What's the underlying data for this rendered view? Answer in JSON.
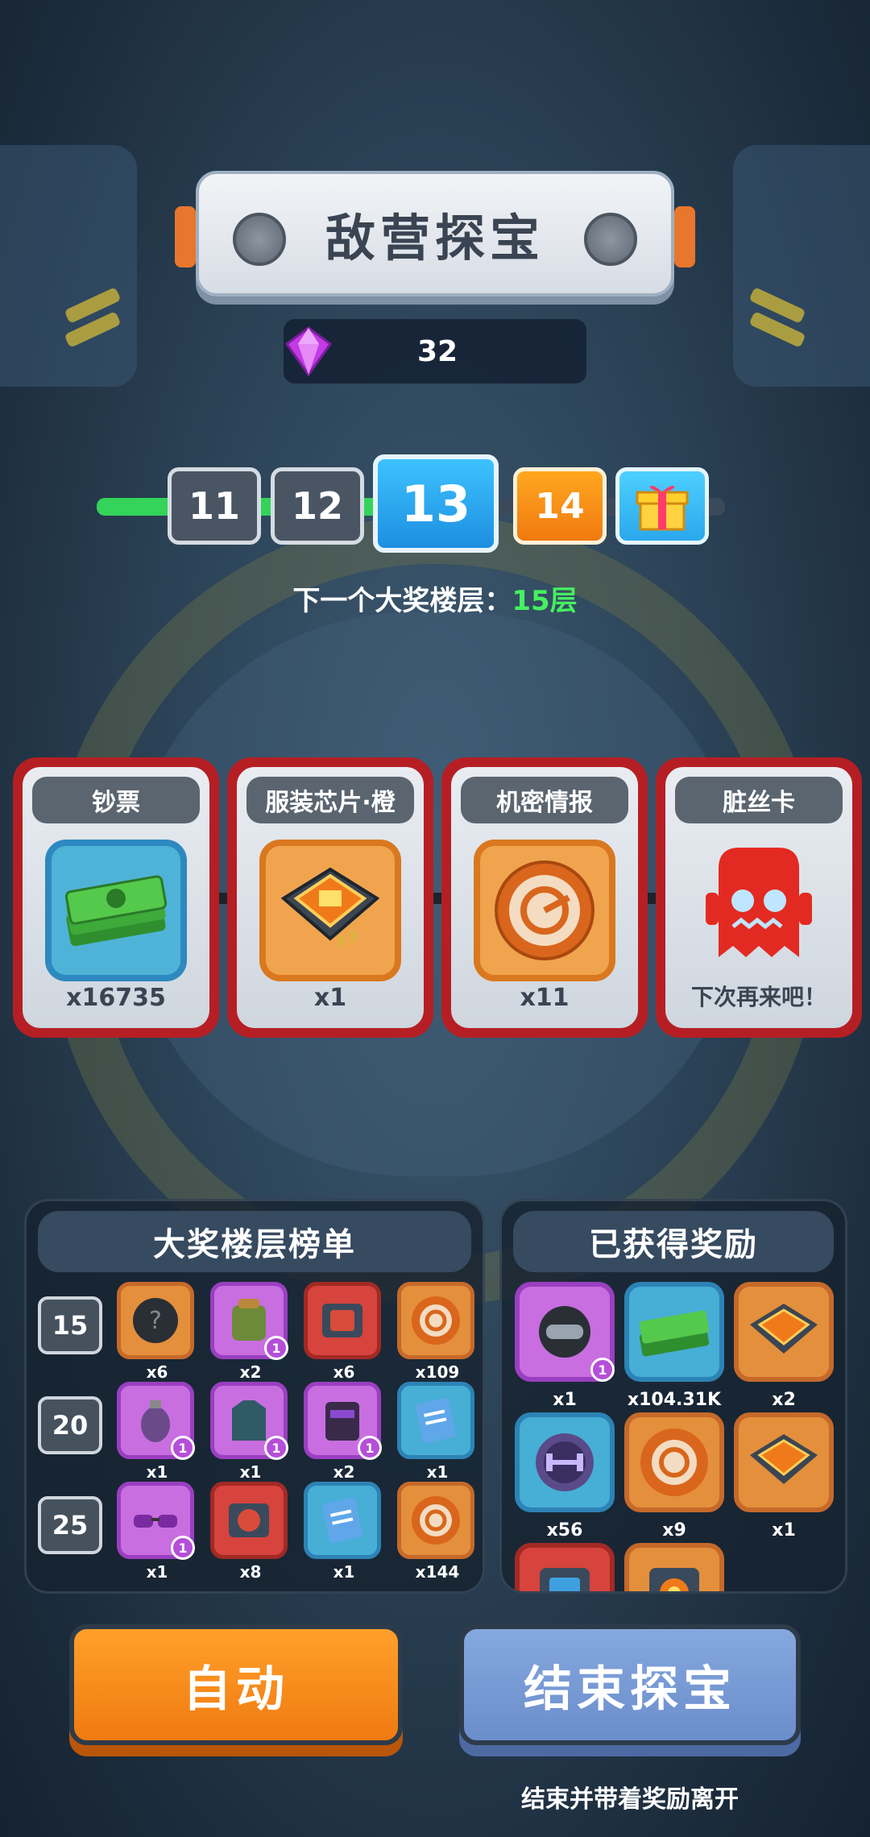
{
  "header": {
    "title": "敌营探宝"
  },
  "currency": {
    "gems": "32",
    "icon": "purple-gem-icon"
  },
  "floors": {
    "items": [
      "11",
      "12",
      "13",
      "14"
    ],
    "current": "13",
    "gift_icon": "gift-icon"
  },
  "next_jackpot": {
    "label": "下一个大奖楼层：",
    "value": "15层"
  },
  "reward_cards": [
    {
      "title": "钞票",
      "qty": "x16735",
      "icon": "cash-stack-icon"
    },
    {
      "title": "服装芯片·橙",
      "qty": "x1",
      "icon": "chip-icon"
    },
    {
      "title": "机密情报",
      "qty": "x11",
      "icon": "intel-coin-icon"
    },
    {
      "title": "脏丝卡",
      "qty": "下次再来吧！",
      "icon": "red-ghost-icon"
    }
  ],
  "jackpot_board": {
    "title": "大奖楼层榜单",
    "rows": [
      {
        "floor": "15",
        "items": [
          {
            "qty": "x6",
            "color": "orange",
            "icon": "mystery-helmet-icon",
            "badge": ""
          },
          {
            "qty": "x2",
            "color": "purple",
            "icon": "backpack-icon",
            "badge": "1"
          },
          {
            "qty": "x6",
            "color": "red",
            "icon": "armor-chip-icon",
            "badge": ""
          },
          {
            "qty": "x109",
            "color": "orange",
            "icon": "intel-coin-icon",
            "badge": ""
          }
        ]
      },
      {
        "floor": "20",
        "items": [
          {
            "qty": "x1",
            "color": "purple",
            "icon": "grenade-icon",
            "badge": "1"
          },
          {
            "qty": "x1",
            "color": "purple",
            "icon": "jacket-icon",
            "badge": "1"
          },
          {
            "qty": "x2",
            "color": "purple",
            "icon": "vest-icon",
            "badge": "1"
          },
          {
            "qty": "x1",
            "color": "blue",
            "icon": "document-icon",
            "badge": ""
          }
        ]
      },
      {
        "floor": "25",
        "items": [
          {
            "qty": "x1",
            "color": "purple",
            "icon": "sunglasses-icon",
            "badge": "1"
          },
          {
            "qty": "x8",
            "color": "red",
            "icon": "helmet-chip-icon",
            "badge": ""
          },
          {
            "qty": "x1",
            "color": "blue",
            "icon": "document-icon",
            "badge": ""
          },
          {
            "qty": "x144",
            "color": "orange",
            "icon": "intel-coin-icon",
            "badge": ""
          }
        ]
      }
    ]
  },
  "earned_rewards": {
    "title": "已获得奖励",
    "items": [
      {
        "qty": "x1",
        "color": "purple",
        "icon": "helmet-icon",
        "badge": "1"
      },
      {
        "qty": "x104.31K",
        "color": "blue",
        "icon": "cash-stack-icon",
        "badge": ""
      },
      {
        "qty": "x2",
        "color": "orange",
        "icon": "chip-icon",
        "badge": ""
      },
      {
        "qty": "x56",
        "color": "blue",
        "icon": "dumbbell-coin-icon",
        "badge": ""
      },
      {
        "qty": "x9",
        "color": "orange",
        "icon": "intel-coin-icon",
        "badge": ""
      },
      {
        "qty": "x1",
        "color": "orange",
        "icon": "chip-icon",
        "badge": ""
      },
      {
        "qty": "",
        "color": "red",
        "icon": "blue-chip-icon",
        "badge": ""
      },
      {
        "qty": "",
        "color": "orange",
        "icon": "gear-coin-icon",
        "badge": ""
      }
    ]
  },
  "actions": {
    "auto_label": "自动",
    "end_label": "结束探宝",
    "end_sub": "结束并带着奖励离开"
  }
}
